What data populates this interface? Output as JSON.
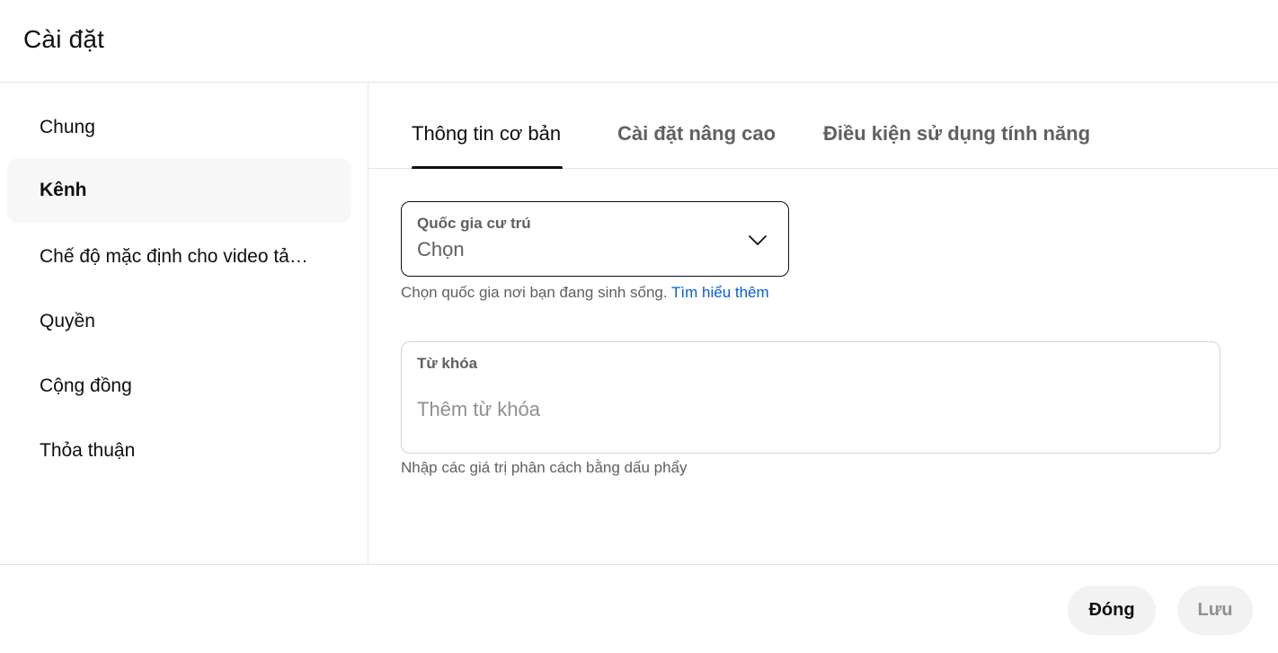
{
  "dialog": {
    "title": "Cài đặt"
  },
  "sidebar": {
    "items": [
      {
        "label": "Chung"
      },
      {
        "label": "Kênh"
      },
      {
        "label": "Chế độ mặc định cho video tải lên"
      },
      {
        "label": "Quyền"
      },
      {
        "label": "Cộng đồng"
      },
      {
        "label": "Thỏa thuận"
      }
    ],
    "active": "Kênh"
  },
  "tabs": [
    {
      "label": "Thông tin cơ bản"
    },
    {
      "label": "Cài đặt nâng cao"
    },
    {
      "label": "Điều kiện sử dụng tính năng"
    }
  ],
  "country": {
    "label": "Quốc gia cư trú",
    "value": "Chọn",
    "helper": "Chọn quốc gia nơi bạn đang sinh sống.",
    "link": "Tìm hiểu thêm"
  },
  "keywords": {
    "label": "Từ khóa",
    "value": "",
    "placeholder": "Thêm từ khóa",
    "helper": "Nhập các giá trị phân cách bằng dấu phẩy"
  },
  "footer": {
    "close_label": "Đóng",
    "save_label": "Lưu"
  },
  "icons": {
    "country_dropdown": "chevron-down-icon"
  },
  "colors": {
    "link": "#065fd4",
    "active_nav_bg": "#f7f7f7",
    "button_bg": "#f2f2f2",
    "disabled_text": "#909090"
  }
}
